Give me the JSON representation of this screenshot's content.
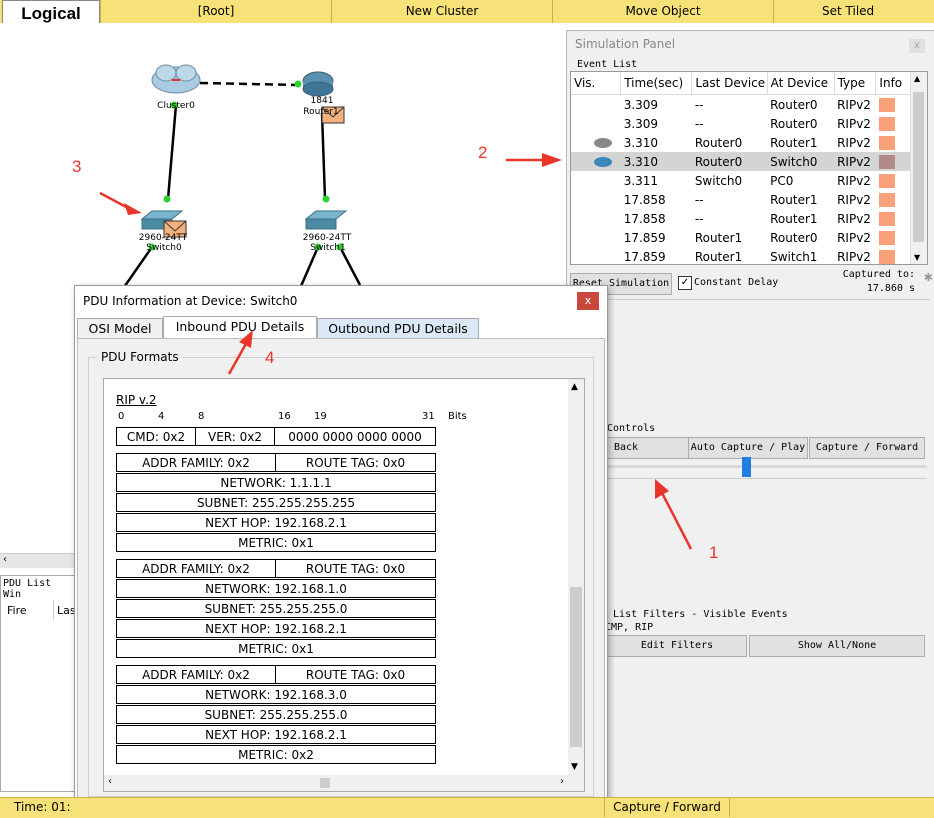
{
  "topbar": {
    "logical": "Logical",
    "root": "[Root]",
    "new_cluster": "New Cluster",
    "move_object": "Move Object",
    "set_tiled": "Set Tiled Backgrou"
  },
  "devices": {
    "cluster": "Cluster0",
    "router_model": "1841",
    "router": "Router1",
    "switch0_model": "2960-24TT",
    "switch0": "Switch0",
    "switch1_model": "2960-24TT",
    "switch1": "Switch1"
  },
  "annotations": {
    "a1": "1",
    "a2": "2",
    "a3": "3",
    "a4": "4"
  },
  "simulation": {
    "title": "Simulation Panel",
    "event_list": "Event List",
    "columns": [
      "Vis.",
      "Time(sec)",
      "Last Device",
      "At Device",
      "Type",
      "Info"
    ],
    "events": [
      {
        "time": "3.309",
        "last": "--",
        "at": "Router0",
        "type": "RIPv2",
        "color": "#f8a07a"
      },
      {
        "time": "3.309",
        "last": "--",
        "at": "Router0",
        "type": "RIPv2",
        "color": "#f8a07a"
      },
      {
        "time": "3.310",
        "last": "Router0",
        "at": "Router1",
        "type": "RIPv2",
        "color": "#f8a07a"
      },
      {
        "time": "3.310",
        "last": "Router0",
        "at": "Switch0",
        "type": "RIPv2",
        "color": "#b38a8a"
      },
      {
        "time": "3.311",
        "last": "Switch0",
        "at": "PC0",
        "type": "RIPv2",
        "color": "#f8a07a"
      },
      {
        "time": "17.858",
        "last": "--",
        "at": "Router1",
        "type": "RIPv2",
        "color": "#f8a07a"
      },
      {
        "time": "17.858",
        "last": "--",
        "at": "Router1",
        "type": "RIPv2",
        "color": "#f8a07a"
      },
      {
        "time": "17.859",
        "last": "Router1",
        "at": "Router0",
        "type": "RIPv2",
        "color": "#f8a07a"
      },
      {
        "time": "17.859",
        "last": "Router1",
        "at": "Switch1",
        "type": "RIPv2",
        "color": "#f8a07a"
      }
    ],
    "reset": "Reset Simulation",
    "constant_delay": "Constant Delay",
    "captured_label": "Captured to:",
    "captured_value": "17.860 s",
    "controls": "Controls",
    "back": "Back",
    "auto_capture": "Auto Capture / Play",
    "capture_forward": "Capture / Forward",
    "filters_label": ": List Filters - Visible Events",
    "filters_value": "CMP, RIP",
    "edit_filters": "Edit Filters",
    "show_all": "Show All/None"
  },
  "pdu_window": {
    "title": "PDU Information at Device: Switch0",
    "close": "x",
    "tabs": [
      "OSI Model",
      "Inbound PDU Details",
      "Outbound PDU Details"
    ],
    "legend": "PDU Formats",
    "protocol": "RIP v.2",
    "bits": [
      "0",
      "4",
      "8",
      "16",
      "19",
      "31",
      "Bits"
    ],
    "header": {
      "cmd": "CMD: 0x2",
      "ver": "VER: 0x2",
      "zero": "0000 0000 0000 0000"
    },
    "routes": [
      {
        "family": "ADDR FAMILY: 0x2",
        "tag": "ROUTE TAG: 0x0",
        "network": "NETWORK: 1.1.1.1",
        "subnet": "SUBNET: 255.255.255.255",
        "nexthop": "NEXT HOP: 192.168.2.1",
        "metric": "METRIC: 0x1"
      },
      {
        "family": "ADDR FAMILY: 0x2",
        "tag": "ROUTE TAG: 0x0",
        "network": "NETWORK: 192.168.1.0",
        "subnet": "SUBNET: 255.255.255.0",
        "nexthop": "NEXT HOP: 192.168.2.1",
        "metric": "METRIC: 0x1"
      },
      {
        "family": "ADDR FAMILY: 0x2",
        "tag": "ROUTE TAG: 0x0",
        "network": "NETWORK: 192.168.3.0",
        "subnet": "SUBNET: 255.255.255.0",
        "nexthop": "NEXT HOP: 192.168.2.1",
        "metric": "METRIC: 0x2"
      }
    ]
  },
  "bottom": {
    "pdu_list": "PDU List Win",
    "fire": "Fire",
    "last": "Las",
    "time": "Time: 01:",
    "capture_forward": "Capture / Forward"
  }
}
